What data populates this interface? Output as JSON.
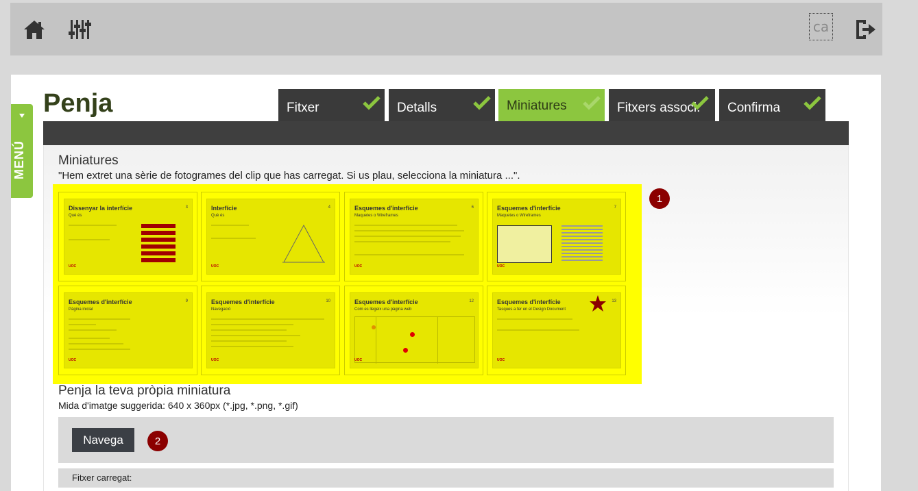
{
  "header": {
    "home_icon": "home-icon",
    "settings_icon": "sliders-icon",
    "language": "ca",
    "logout_icon": "logout-icon"
  },
  "menu": {
    "label": "MENÚ"
  },
  "page": {
    "title": "Penja"
  },
  "tabs": [
    {
      "label": "Fitxer",
      "done": true
    },
    {
      "label": "Detalls",
      "done": true
    },
    {
      "label": "Miniatures",
      "done": true,
      "active": true
    },
    {
      "label": "Fitxers associ.",
      "done": true
    },
    {
      "label": "Confirma",
      "done": true
    }
  ],
  "miniatures": {
    "title": "Miniatures",
    "description": "\"Hem extret una sèrie de fotogrames del clip que has carregat. Si us plau, selecciona la miniatura ...\".",
    "thumbnails": [
      {
        "title": "Dissenyar la interfície",
        "num": "3",
        "subtitle": "Què és"
      },
      {
        "title": "Interfície",
        "num": "4",
        "subtitle": "Què és"
      },
      {
        "title": "Esquemes d'interfície",
        "num": "6",
        "subtitle": "Maquetes o Wireframes"
      },
      {
        "title": "Esquemes d'interfície",
        "num": "7",
        "subtitle": "Maquetes o Wireframes"
      },
      {
        "title": "Esquemes d'interfície",
        "num": "9",
        "subtitle": "Pàgina inicial"
      },
      {
        "title": "Esquemes d'interfície",
        "num": "10",
        "subtitle": "Navegació"
      },
      {
        "title": "Esquemes d'interfície",
        "num": "12",
        "subtitle": "Com es llegeix una pàgina web"
      },
      {
        "title": "Esquemes d'interfície",
        "num": "13",
        "subtitle": "Tasques a fer en el Design Document"
      }
    ],
    "highlight_color": "#ffff00"
  },
  "badges": {
    "one": "1",
    "two": "2"
  },
  "own": {
    "title": "Penja la teva pròpia miniatura",
    "hint": "Mida d'imatge suggerida: 640 x 360px (*.jpg, *.png, *.gif)",
    "browse_label": "Navega",
    "loaded_label": "Fitxer carregat:"
  },
  "colors": {
    "accent": "#8cc63f",
    "dark": "#3a3a3a",
    "badge": "#8b0000"
  }
}
